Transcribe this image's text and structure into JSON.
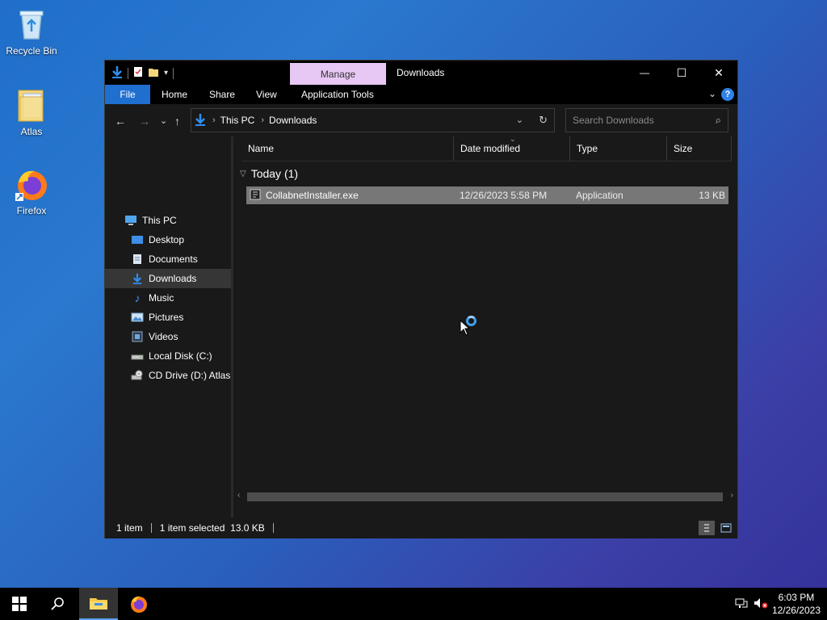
{
  "desktop": {
    "icons": [
      {
        "label": "Recycle Bin",
        "icon": "recycle-bin-icon"
      },
      {
        "label": "Atlas",
        "icon": "folder-icon"
      },
      {
        "label": "Firefox",
        "icon": "firefox-icon"
      }
    ]
  },
  "window": {
    "title": "Downloads",
    "manage_tab": "Manage",
    "controls": {
      "minimize": "—",
      "maximize": "☐",
      "close": "✕"
    }
  },
  "ribbon": {
    "tabs": [
      "File",
      "Home",
      "Share",
      "View",
      "Application Tools"
    ],
    "help": "?",
    "collapse": "⌄"
  },
  "navigation": {
    "back": "←",
    "forward": "→",
    "recent": "⌄",
    "up": "↑",
    "address": [
      "This PC",
      "Downloads"
    ],
    "address_dropdown": "⌄",
    "refresh": "↻",
    "search_placeholder": "Search Downloads",
    "search_icon": "⌕"
  },
  "sidebar": {
    "items": [
      {
        "label": "This PC",
        "icon": "computer-icon"
      },
      {
        "label": "Desktop",
        "icon": "desktop-icon"
      },
      {
        "label": "Documents",
        "icon": "documents-icon"
      },
      {
        "label": "Downloads",
        "icon": "download-arrow-icon",
        "selected": true
      },
      {
        "label": "Music",
        "icon": "music-note-icon"
      },
      {
        "label": "Pictures",
        "icon": "pictures-icon"
      },
      {
        "label": "Videos",
        "icon": "videos-icon"
      },
      {
        "label": "Local Disk (C:)",
        "icon": "hard-drive-icon"
      },
      {
        "label": "CD Drive (D:) Atlas",
        "icon": "cd-drive-icon"
      }
    ]
  },
  "file_list": {
    "columns": [
      "Name",
      "Date modified",
      "Type",
      "Size"
    ],
    "group": "Today (1)",
    "rows": [
      {
        "name": "CollabnetInstaller.exe",
        "date": "12/26/2023 5:58 PM",
        "type": "Application",
        "size": "13 KB"
      }
    ]
  },
  "status": {
    "count": "1 item",
    "selection": "1 item selected  13.0 KB"
  },
  "taskbar": {
    "time": "6:03 PM",
    "date": "12/26/2023"
  },
  "colors": {
    "accent": "#1f6fd1",
    "manage_tab": "#e7c7f3",
    "selected_row": "#777777",
    "window_bg": "#191919"
  }
}
